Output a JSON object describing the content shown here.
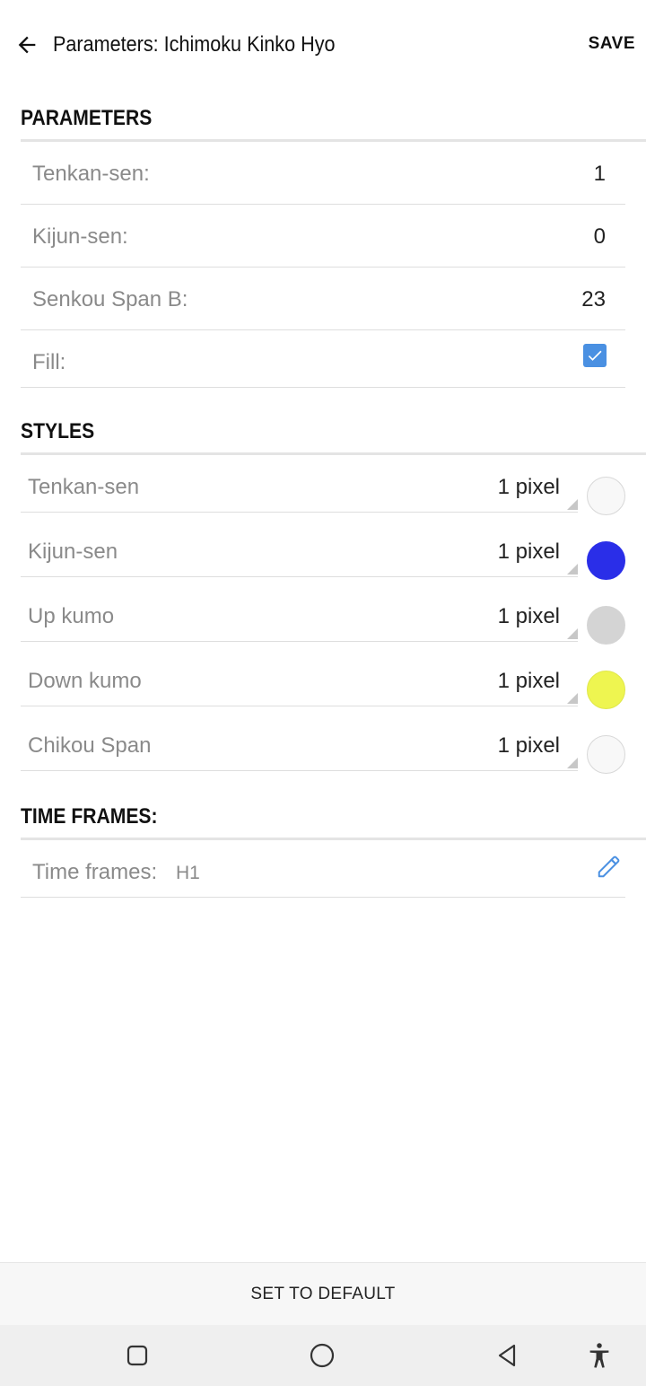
{
  "appbar": {
    "title": "Parameters: Ichimoku Kinko Hyo",
    "save_label": "SAVE",
    "back_icon": "arrow-left-icon"
  },
  "parameters": {
    "header": "PARAMETERS",
    "rows": [
      {
        "label": "Tenkan-sen:",
        "value": "1"
      },
      {
        "label": "Kijun-sen:",
        "value": "0"
      },
      {
        "label": "Senkou Span B:",
        "value": "23"
      }
    ],
    "fill": {
      "label": "Fill:",
      "checked": true,
      "color": "#4a90e2"
    }
  },
  "styles": {
    "header": "STYLES",
    "rows": [
      {
        "label": "Tenkan-sen",
        "value": "1 pixel",
        "color": "#f8f8f8"
      },
      {
        "label": "Kijun-sen",
        "value": "1 pixel",
        "color": "#2a2ee8"
      },
      {
        "label": "Up kumo",
        "value": "1 pixel",
        "color": "#d4d4d4"
      },
      {
        "label": "Down kumo",
        "value": "1 pixel",
        "color": "#eef550"
      },
      {
        "label": "Chikou Span",
        "value": "1 pixel",
        "color": "#f8f8f8"
      }
    ]
  },
  "timeframes": {
    "header": "TIME FRAMES:",
    "label": "Time frames:",
    "value": "H1",
    "edit_icon": "pencil-icon"
  },
  "footer": {
    "default_label": "SET TO DEFAULT"
  },
  "navbar": {
    "icons": [
      "recents-square-icon",
      "home-circle-icon",
      "back-triangle-icon",
      "accessibility-icon"
    ]
  }
}
